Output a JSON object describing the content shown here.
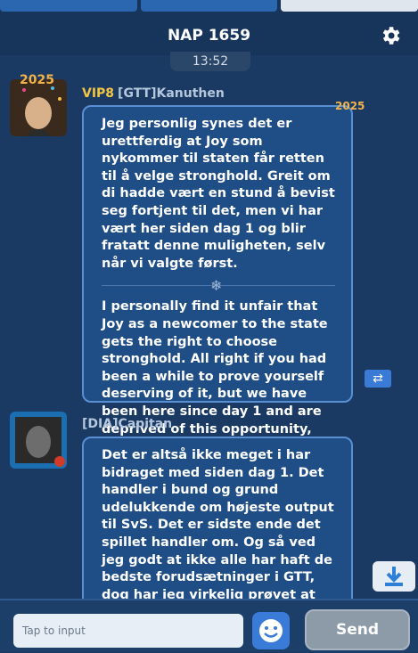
{
  "header": {
    "title": "NAP 1659"
  },
  "chat": {
    "time": "13:52",
    "messages": [
      {
        "vip": "VIP8",
        "sender": "[GTT]Kanuthen",
        "avatar_badge": "2025",
        "bubble_badge": "2025",
        "original": "Jeg personlig synes det er urettferdig at Joy som nykommer til staten får retten til å velge stronghold. Greit om di hadde vært en stund å bevist seg fortjent til det, men vi har vært her siden dag 1 og blir fratatt denne muligheten, selv når vi valgte først.",
        "translation": "I personally find it unfair that Joy as a newcomer to the state gets the right to choose stronghold. All right if you had been a while to prove yourself deserving of it, but we have been here since day 1 and are deprived of this opportunity, even when we chose first."
      },
      {
        "sender": "[DIA]Capitan",
        "original": "Det er altså ikke meget i har bidraget med siden dag 1. Det handler i bund og grund udelukkende om højeste output til SvS. Det er sidste ende det spillet handler om. Og så ved jeg godt at ikke alle har haft de bedste forudsætninger i GTT, dog har jeg virkelig prøvet at lave om på det. Lige nu og her er det bare ikke den bedste"
      }
    ]
  },
  "input": {
    "placeholder": "Tap to input"
  },
  "buttons": {
    "send_label": "Send"
  },
  "icons": {
    "gear": "gear-icon",
    "translate": "swap-arrows-icon",
    "download": "download-icon",
    "emoji": "smiley-icon"
  },
  "colors": {
    "background": "#1a3a63",
    "bubble": "#1f4d86",
    "bubble_border": "#5b8fd3",
    "vip": "#f4c542",
    "accent": "#3b7bd8"
  }
}
